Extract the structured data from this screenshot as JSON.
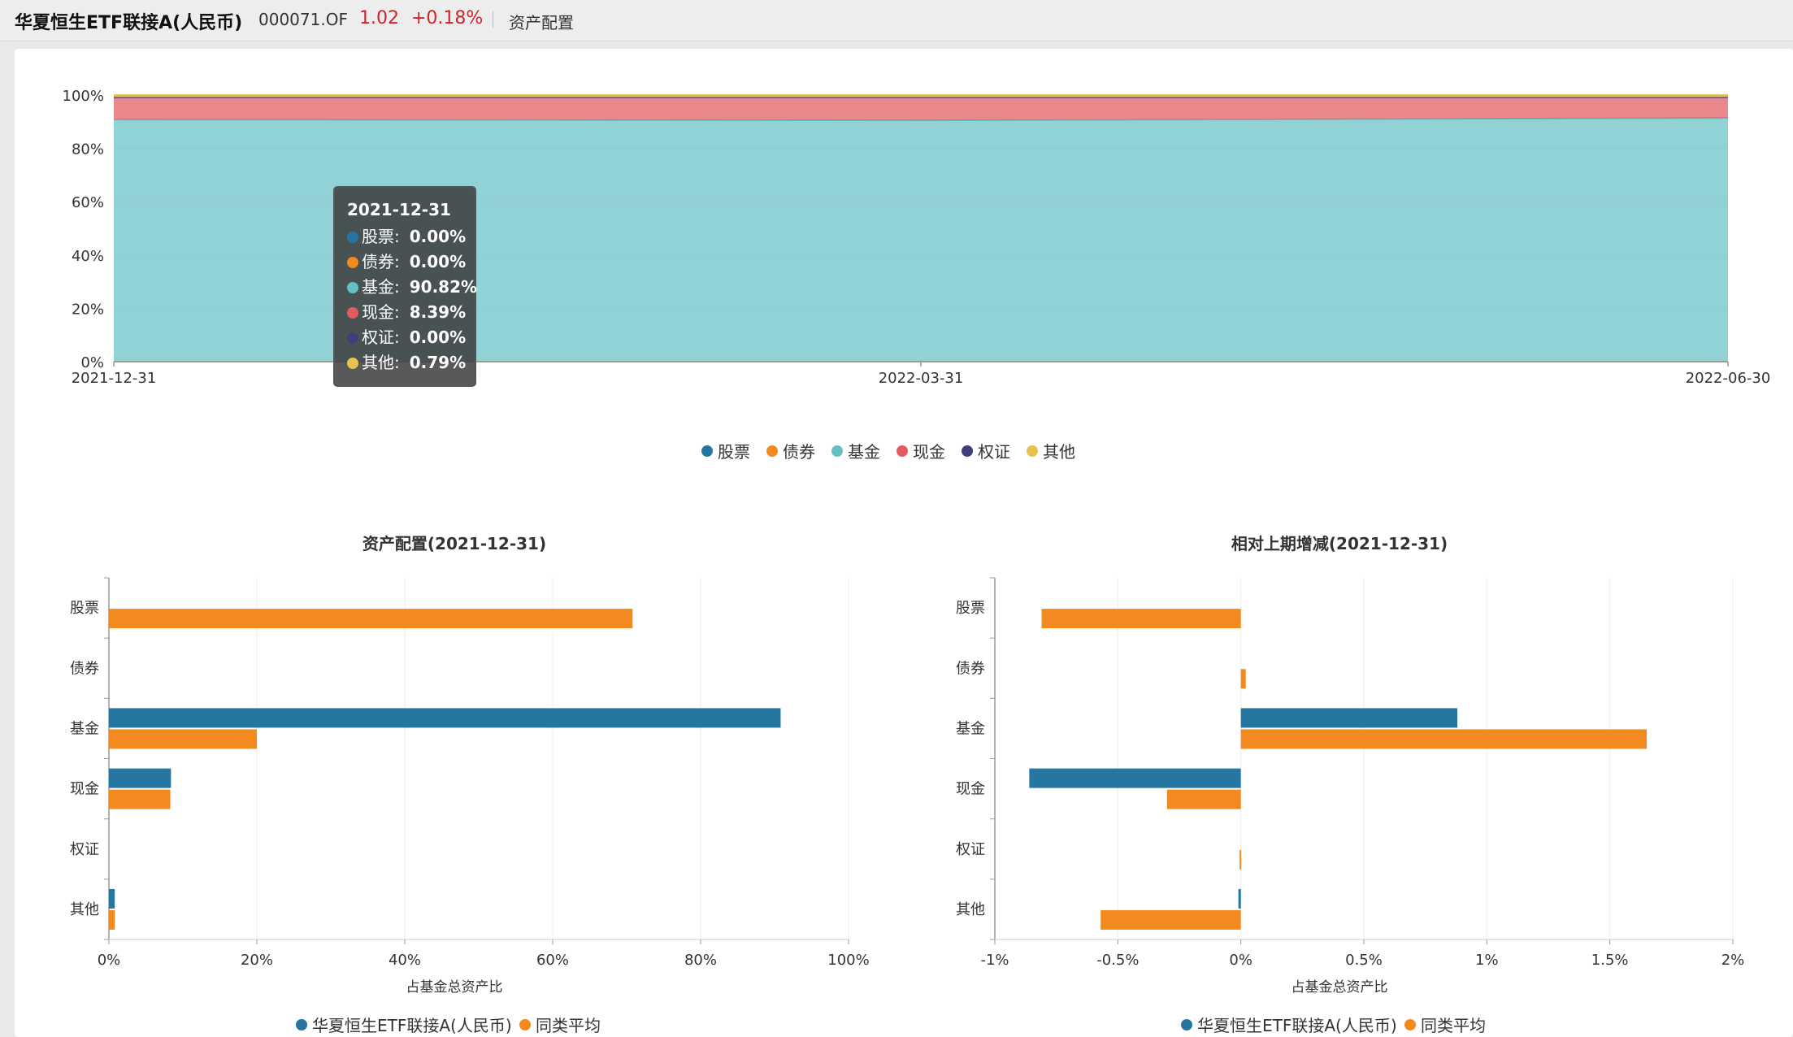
{
  "header": {
    "fund_name": "华夏恒生ETF联接A(人民币)",
    "fund_code": "000071.OF",
    "price": "1.02",
    "change": "+0.18%",
    "section": "资产配置"
  },
  "colors": {
    "股票": "#2577a2",
    "债券": "#f28a1f",
    "基金": "#66c0c3",
    "现金": "#e25b61",
    "权证": "#3f3f7c",
    "其他": "#e6c250"
  },
  "tooltip": {
    "date": "2021-12-31",
    "rows": [
      {
        "label": "股票:",
        "value": "0.00%",
        "color": "#2577a2"
      },
      {
        "label": "债券:",
        "value": "0.00%",
        "color": "#f28a1f"
      },
      {
        "label": "基金:",
        "value": "90.82%",
        "color": "#66c0c3"
      },
      {
        "label": "现金:",
        "value": "8.39%",
        "color": "#e25b61"
      },
      {
        "label": "权证:",
        "value": "0.00%",
        "color": "#3f3f7c"
      },
      {
        "label": "其他:",
        "value": "0.79%",
        "color": "#e6c250"
      }
    ]
  },
  "chart_data": [
    {
      "type": "area",
      "stacked": true,
      "x": [
        "2021-12-31",
        "2022-03-31",
        "2022-06-30"
      ],
      "yticks": [
        "0%",
        "20%",
        "40%",
        "60%",
        "80%",
        "100%"
      ],
      "ylim": [
        0,
        100
      ],
      "series": [
        {
          "name": "股票",
          "values": [
            0,
            0,
            0
          ]
        },
        {
          "name": "债券",
          "values": [
            0,
            0,
            0
          ]
        },
        {
          "name": "基金",
          "values": [
            90.82,
            90.5,
            91.4
          ]
        },
        {
          "name": "现金",
          "values": [
            8.39,
            8.7,
            7.8
          ]
        },
        {
          "name": "权证",
          "values": [
            0,
            0,
            0
          ]
        },
        {
          "name": "其他",
          "values": [
            0.79,
            0.8,
            0.8
          ]
        }
      ],
      "legend": [
        "股票",
        "债券",
        "基金",
        "现金",
        "权证",
        "其他"
      ],
      "legend_position": "bottom-center"
    },
    {
      "type": "bar",
      "orientation": "horizontal",
      "title": "资产配置(2021-12-31)",
      "categories": [
        "股票",
        "债券",
        "基金",
        "现金",
        "权证",
        "其他"
      ],
      "xlabel": "占基金总资产比",
      "xticks": [
        "0%",
        "20%",
        "40%",
        "60%",
        "80%",
        "100%"
      ],
      "xlim": [
        0,
        100
      ],
      "series": [
        {
          "name": "华夏恒生ETF联接A(人民币)",
          "values": [
            0,
            0,
            90.82,
            8.39,
            0,
            0.79
          ]
        },
        {
          "name": "同类平均",
          "values": [
            70.8,
            0,
            20.0,
            8.3,
            0,
            0.8
          ]
        }
      ],
      "legend": [
        "华夏恒生ETF联接A(人民币)",
        "同类平均"
      ],
      "legend_position": "bottom-center"
    },
    {
      "type": "bar",
      "orientation": "horizontal",
      "title": "相对上期增减(2021-12-31)",
      "categories": [
        "股票",
        "债券",
        "基金",
        "现金",
        "权证",
        "其他"
      ],
      "xlabel": "占基金总资产比",
      "xticks": [
        "-1%",
        "-0.5%",
        "0%",
        "0.5%",
        "1%",
        "1.5%",
        "2%"
      ],
      "xlim": [
        -1,
        2
      ],
      "series": [
        {
          "name": "华夏恒生ETF联接A(人民币)",
          "values": [
            0,
            0,
            0.88,
            -0.86,
            0,
            -0.01
          ]
        },
        {
          "name": "同类平均",
          "values": [
            -0.81,
            0.02,
            1.65,
            -0.3,
            -0.005,
            -0.57
          ]
        }
      ],
      "legend": [
        "华夏恒生ETF联接A(人民币)",
        "同类平均"
      ],
      "legend_position": "bottom-center"
    }
  ]
}
